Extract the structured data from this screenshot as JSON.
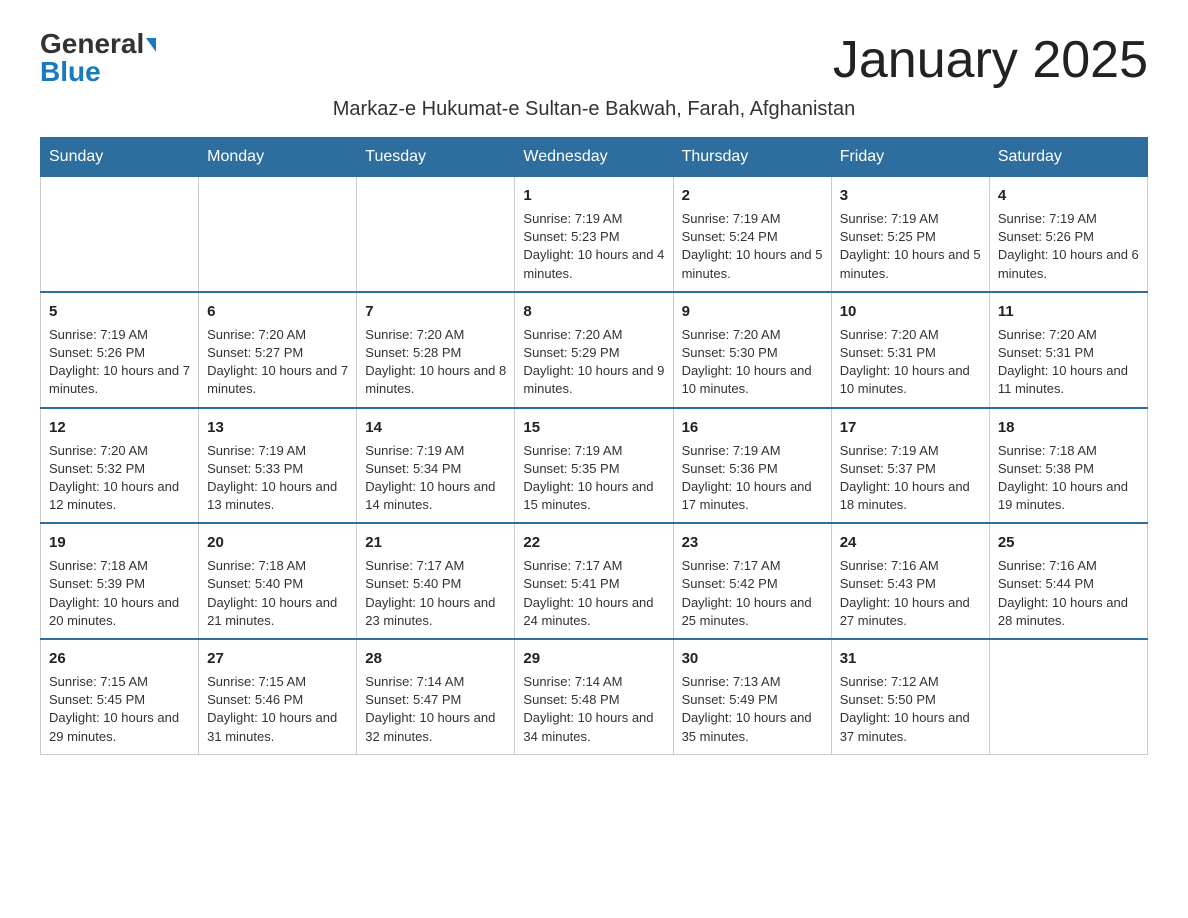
{
  "logo": {
    "general": "General",
    "blue": "Blue"
  },
  "title": "January 2025",
  "subtitle": "Markaz-e Hukumat-e Sultan-e Bakwah, Farah, Afghanistan",
  "weekdays": [
    "Sunday",
    "Monday",
    "Tuesday",
    "Wednesday",
    "Thursday",
    "Friday",
    "Saturday"
  ],
  "weeks": [
    [
      {
        "day": "",
        "info": ""
      },
      {
        "day": "",
        "info": ""
      },
      {
        "day": "",
        "info": ""
      },
      {
        "day": "1",
        "info": "Sunrise: 7:19 AM\nSunset: 5:23 PM\nDaylight: 10 hours and 4 minutes."
      },
      {
        "day": "2",
        "info": "Sunrise: 7:19 AM\nSunset: 5:24 PM\nDaylight: 10 hours and 5 minutes."
      },
      {
        "day": "3",
        "info": "Sunrise: 7:19 AM\nSunset: 5:25 PM\nDaylight: 10 hours and 5 minutes."
      },
      {
        "day": "4",
        "info": "Sunrise: 7:19 AM\nSunset: 5:26 PM\nDaylight: 10 hours and 6 minutes."
      }
    ],
    [
      {
        "day": "5",
        "info": "Sunrise: 7:19 AM\nSunset: 5:26 PM\nDaylight: 10 hours and 7 minutes."
      },
      {
        "day": "6",
        "info": "Sunrise: 7:20 AM\nSunset: 5:27 PM\nDaylight: 10 hours and 7 minutes."
      },
      {
        "day": "7",
        "info": "Sunrise: 7:20 AM\nSunset: 5:28 PM\nDaylight: 10 hours and 8 minutes."
      },
      {
        "day": "8",
        "info": "Sunrise: 7:20 AM\nSunset: 5:29 PM\nDaylight: 10 hours and 9 minutes."
      },
      {
        "day": "9",
        "info": "Sunrise: 7:20 AM\nSunset: 5:30 PM\nDaylight: 10 hours and 10 minutes."
      },
      {
        "day": "10",
        "info": "Sunrise: 7:20 AM\nSunset: 5:31 PM\nDaylight: 10 hours and 10 minutes."
      },
      {
        "day": "11",
        "info": "Sunrise: 7:20 AM\nSunset: 5:31 PM\nDaylight: 10 hours and 11 minutes."
      }
    ],
    [
      {
        "day": "12",
        "info": "Sunrise: 7:20 AM\nSunset: 5:32 PM\nDaylight: 10 hours and 12 minutes."
      },
      {
        "day": "13",
        "info": "Sunrise: 7:19 AM\nSunset: 5:33 PM\nDaylight: 10 hours and 13 minutes."
      },
      {
        "day": "14",
        "info": "Sunrise: 7:19 AM\nSunset: 5:34 PM\nDaylight: 10 hours and 14 minutes."
      },
      {
        "day": "15",
        "info": "Sunrise: 7:19 AM\nSunset: 5:35 PM\nDaylight: 10 hours and 15 minutes."
      },
      {
        "day": "16",
        "info": "Sunrise: 7:19 AM\nSunset: 5:36 PM\nDaylight: 10 hours and 17 minutes."
      },
      {
        "day": "17",
        "info": "Sunrise: 7:19 AM\nSunset: 5:37 PM\nDaylight: 10 hours and 18 minutes."
      },
      {
        "day": "18",
        "info": "Sunrise: 7:18 AM\nSunset: 5:38 PM\nDaylight: 10 hours and 19 minutes."
      }
    ],
    [
      {
        "day": "19",
        "info": "Sunrise: 7:18 AM\nSunset: 5:39 PM\nDaylight: 10 hours and 20 minutes."
      },
      {
        "day": "20",
        "info": "Sunrise: 7:18 AM\nSunset: 5:40 PM\nDaylight: 10 hours and 21 minutes."
      },
      {
        "day": "21",
        "info": "Sunrise: 7:17 AM\nSunset: 5:40 PM\nDaylight: 10 hours and 23 minutes."
      },
      {
        "day": "22",
        "info": "Sunrise: 7:17 AM\nSunset: 5:41 PM\nDaylight: 10 hours and 24 minutes."
      },
      {
        "day": "23",
        "info": "Sunrise: 7:17 AM\nSunset: 5:42 PM\nDaylight: 10 hours and 25 minutes."
      },
      {
        "day": "24",
        "info": "Sunrise: 7:16 AM\nSunset: 5:43 PM\nDaylight: 10 hours and 27 minutes."
      },
      {
        "day": "25",
        "info": "Sunrise: 7:16 AM\nSunset: 5:44 PM\nDaylight: 10 hours and 28 minutes."
      }
    ],
    [
      {
        "day": "26",
        "info": "Sunrise: 7:15 AM\nSunset: 5:45 PM\nDaylight: 10 hours and 29 minutes."
      },
      {
        "day": "27",
        "info": "Sunrise: 7:15 AM\nSunset: 5:46 PM\nDaylight: 10 hours and 31 minutes."
      },
      {
        "day": "28",
        "info": "Sunrise: 7:14 AM\nSunset: 5:47 PM\nDaylight: 10 hours and 32 minutes."
      },
      {
        "day": "29",
        "info": "Sunrise: 7:14 AM\nSunset: 5:48 PM\nDaylight: 10 hours and 34 minutes."
      },
      {
        "day": "30",
        "info": "Sunrise: 7:13 AM\nSunset: 5:49 PM\nDaylight: 10 hours and 35 minutes."
      },
      {
        "day": "31",
        "info": "Sunrise: 7:12 AM\nSunset: 5:50 PM\nDaylight: 10 hours and 37 minutes."
      },
      {
        "day": "",
        "info": ""
      }
    ]
  ]
}
